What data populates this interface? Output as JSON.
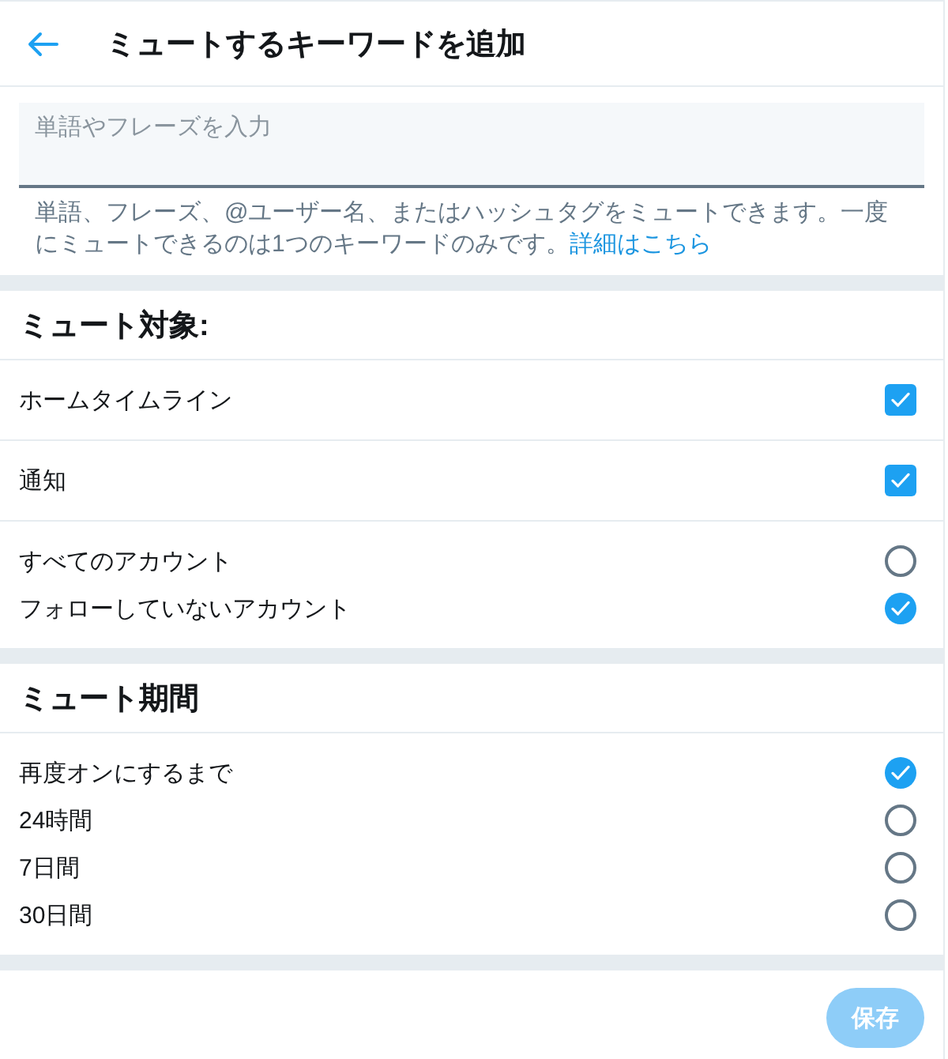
{
  "header": {
    "title": "ミュートするキーワードを追加"
  },
  "keyword_field": {
    "placeholder": "単語やフレーズを入力"
  },
  "help_text": {
    "text": "単語、フレーズ、@ユーザー名、またはハッシュタグをミュートできます。一度にミュートできるのは1つのキーワードのみです。",
    "link": "詳細はこちら"
  },
  "sections": [
    {
      "heading": "ミュート対象:",
      "groups": [
        {
          "kind": "checkbox",
          "items": [
            {
              "label": "ホームタイムライン",
              "checked": true
            }
          ]
        },
        {
          "kind": "checkbox",
          "items": [
            {
              "label": "通知",
              "checked": true
            }
          ]
        },
        {
          "kind": "radio",
          "items": [
            {
              "label": "すべてのアカウント",
              "selected": false
            },
            {
              "label": "フォローしていないアカウント",
              "selected": true
            }
          ]
        }
      ]
    },
    {
      "heading": "ミュート期間",
      "groups": [
        {
          "kind": "radio",
          "items": [
            {
              "label": "再度オンにするまで",
              "selected": true
            },
            {
              "label": "24時間",
              "selected": false
            },
            {
              "label": "7日間",
              "selected": false
            },
            {
              "label": "30日間",
              "selected": false
            }
          ]
        }
      ]
    }
  ],
  "save_button": {
    "label": "保存",
    "disabled": true
  }
}
